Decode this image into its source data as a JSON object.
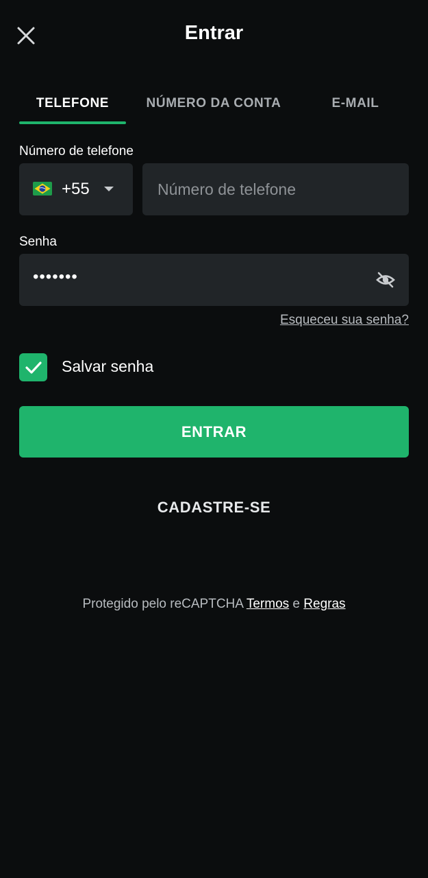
{
  "header": {
    "title": "Entrar",
    "close_icon": "close-icon"
  },
  "tabs": [
    {
      "label": "TELEFONE",
      "active": true
    },
    {
      "label": "NÚMERO DA CONTA",
      "active": false
    },
    {
      "label": "E-MAIL",
      "active": false
    }
  ],
  "phone": {
    "label": "Número de telefone",
    "country_code": "+55",
    "flag_icon": "brazil-flag-icon",
    "placeholder": "Número de telefone",
    "value": ""
  },
  "password": {
    "label": "Senha",
    "masked_value": "•••••••",
    "visibility_icon": "eye-off-icon",
    "forgot_link": "Esqueceu sua senha?"
  },
  "save_password": {
    "label": "Salvar senha",
    "checked": true
  },
  "actions": {
    "login_label": "ENTRAR",
    "register_label": "CADASTRE-SE"
  },
  "footer": {
    "prefix": "Protegido pelo reCAPTCHA",
    "terms": "Termos",
    "joiner": "e",
    "rules": "Regras"
  },
  "colors": {
    "background": "#0b0d0e",
    "field": "#212528",
    "accent": "#1fb46c"
  }
}
